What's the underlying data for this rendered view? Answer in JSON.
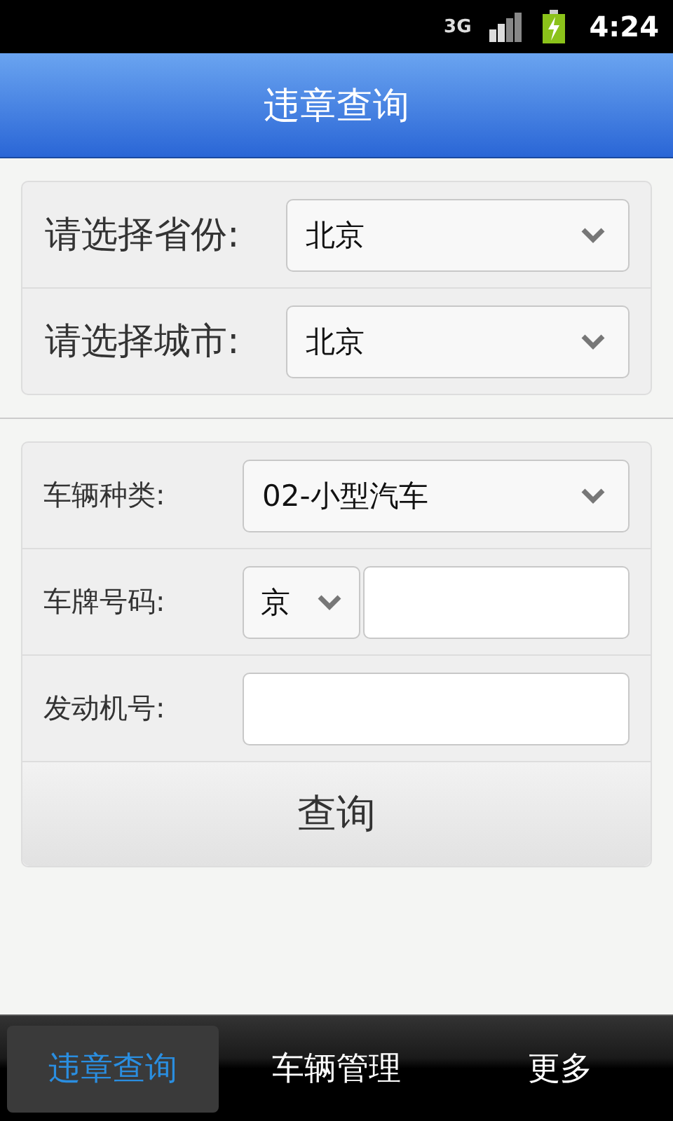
{
  "status_bar": {
    "network": "3G",
    "time": "4:24"
  },
  "header": {
    "title": "违章查询"
  },
  "location": [
    {
      "label": "请选择省份:",
      "value": "北京"
    },
    {
      "label": "请选择城市:",
      "value": "北京"
    }
  ],
  "vehicle": [
    {
      "kind": "select",
      "label": "车辆种类:",
      "value": "02-小型汽车"
    },
    {
      "kind": "plate",
      "label": "车牌号码:",
      "prefix": "京"
    },
    {
      "kind": "input",
      "label": "发动机号:"
    }
  ],
  "query_button": "查询",
  "tabs": [
    {
      "label": "违章查询",
      "selected": true
    },
    {
      "label": "车辆管理",
      "selected": false
    },
    {
      "label": "更多",
      "selected": false
    }
  ]
}
